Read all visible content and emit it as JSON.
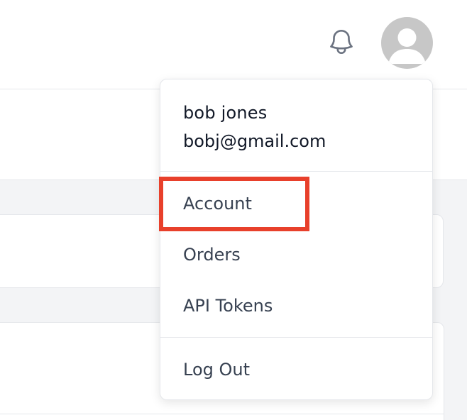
{
  "header": {
    "bell_icon": "bell-outline-icon",
    "avatar_icon": "user-avatar-placeholder"
  },
  "user_menu": {
    "name": "bob jones",
    "email": "bobj@gmail.com",
    "items": [
      {
        "label": "Account"
      },
      {
        "label": "Orders"
      },
      {
        "label": "API Tokens"
      },
      {
        "label": "Log Out"
      }
    ],
    "highlighted_item": "Account"
  },
  "colors": {
    "highlight_border": "#e8402b",
    "avatar_bg": "#c7c7c7",
    "text_primary": "#111827",
    "text_menu": "#374151",
    "border": "#e5e7eb",
    "page_bg": "#f3f4f6"
  }
}
